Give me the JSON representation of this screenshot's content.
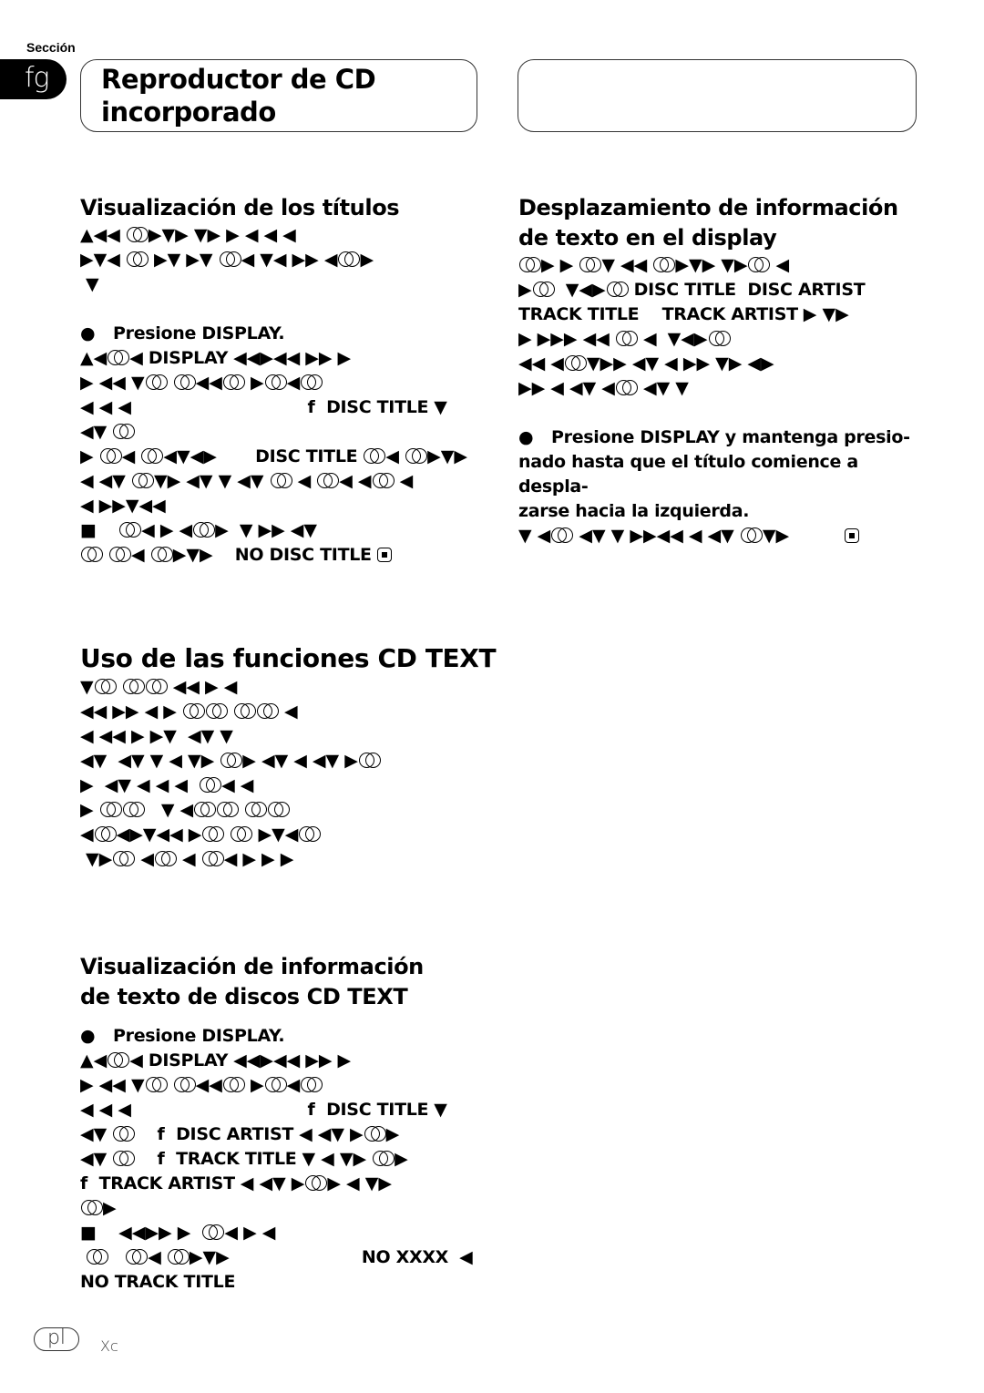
{
  "header": {
    "section_label": "Sección",
    "section_number": "fg",
    "chapter_title_line1": "Reproductor de CD",
    "chapter_title_line2": "incorporado"
  },
  "glyph_legend": {
    "O": "double-circle-glyph",
    "#": "end-mark-icon",
    "note": "Line strings use ▲◀▶▼■ glyphs; O = double circle, # = boxed end mark; **x** = bold"
  },
  "sections": {
    "titles_display": {
      "heading": "Visualización de los títulos",
      "intro_lines": [
        "▲◀◀ O▶▼▶ ▼▶ ▶ ◀ ◀ ◀",
        "▶▼◀ O ▶▼ ▶▼ O◀ ▼◀ ▶▶ ◀O▶",
        " ▼"
      ],
      "step": "Presione DISPLAY.",
      "step_lines": [
        "▲◀O◀ **DISPLAY** ◀◀▶◀◀ ▶▶ ▶",
        "▶ ◀◀ ▼O O◀◀O ▶O◀O",
        "◀ ◀ ◀                                **f  DISC TITLE** ▼",
        "◀▼ O",
        "▶ O◀ O◀▼◀▶       **DISC TITLE** O◀ O▶▼▶",
        "◀ ◀▼ O▼▶ ◀▼ ▼ ◀▼ O ◀ O◀ ◀O ◀",
        "◀ ▶▶▼◀◀",
        "■    O◀ ▶ ◀O▶  ▼ ▶▶ ◀▼",
        "O O◀ O▶▼▶    **NO DISC TITLE** #"
      ]
    },
    "scroll_text": {
      "heading_line1": "Desplazamiento de información",
      "heading_line2": "de texto en el display",
      "intro_lines": [
        "O▶ ▶ O▼ ◀◀ O▶▼▶ ▼▶O ◀",
        "▶O  ▼◀▶O **DISC TITLE  DISC ARTIST**",
        "**TRACK TITLE    TRACK ARTIST** ▶ ▼▶",
        "▶ ▶▶▶ ◀◀ O ◀  ▼◀▶O",
        "◀◀ ◀O▼▶▶ ◀▼ ◀ ▶▶ ▼▶ ◀▶",
        "▶▶ ◀ ◀▼ ◀O ◀▼ ▼"
      ],
      "step": "Presione DISPLAY y mantenga presionado hasta que el título comience a desplazarse hacia la izquierda.",
      "step_wrapped": [
        "Presione DISPLAY y mantenga presio-",
        "nado hasta que el título comience a despla-",
        "zarse hacia la izquierda."
      ],
      "step_lines": [
        "▼ ◀O ◀▼ ▼ ▶▶◀◀ ◀ ◀▼ O▼▶          #"
      ]
    },
    "cd_text": {
      "heading": "Uso de las funciones CD TEXT",
      "lines": [
        "▼O OO ◀◀ ▶ ◀",
        "◀◀ ▶▶ ◀ ▶ OO OO ◀",
        "◀ ◀◀ ▶ ▶▼  ◀▼ ▼",
        "◀▼  ◀▼ ▼ ◀ ▼▶ O▶ ◀▼ ◀ ◀▼ ▶O",
        "▶  ◀▼ ◀ ◀ ◀  O◀ ◀",
        "▶ OO   ▼ ◀OO OO",
        "◀O◀▶▼◀◀ ▶O O ▶▼◀O",
        " ▼▶O ◀O ◀ O◀ ▶ ▶ ▶"
      ]
    },
    "cd_text_display": {
      "heading_line1": "Visualización de información",
      "heading_line2": "de texto de discos CD TEXT",
      "step": "Presione DISPLAY.",
      "step_lines": [
        "▲◀O◀ **DISPLAY** ◀◀▶◀◀ ▶▶ ▶",
        "▶ ◀◀ ▼O O◀◀O ▶O◀O",
        "◀ ◀ ◀                                **f  DISC TITLE** ▼",
        "◀▼ O    **f  DISC ARTIST** ◀ ◀▼ ▶O▶",
        "◀▼ O    **f  TRACK TITLE** ▼ ◀ ▼▶ O▶",
        "**f  TRACK ARTIST** ◀ ◀▼ ▶O▶ ◀ ▼▶",
        "O▶",
        "■    ◀◀▶▶ ▶  O◀ ▶ ◀",
        " O   O◀ O▶▼▶                        **NO XXXX**  ◀",
        "**NO TRACK TITLE**"
      ]
    }
  },
  "footer": {
    "language_badge": "pl",
    "page_code": "Xc"
  }
}
